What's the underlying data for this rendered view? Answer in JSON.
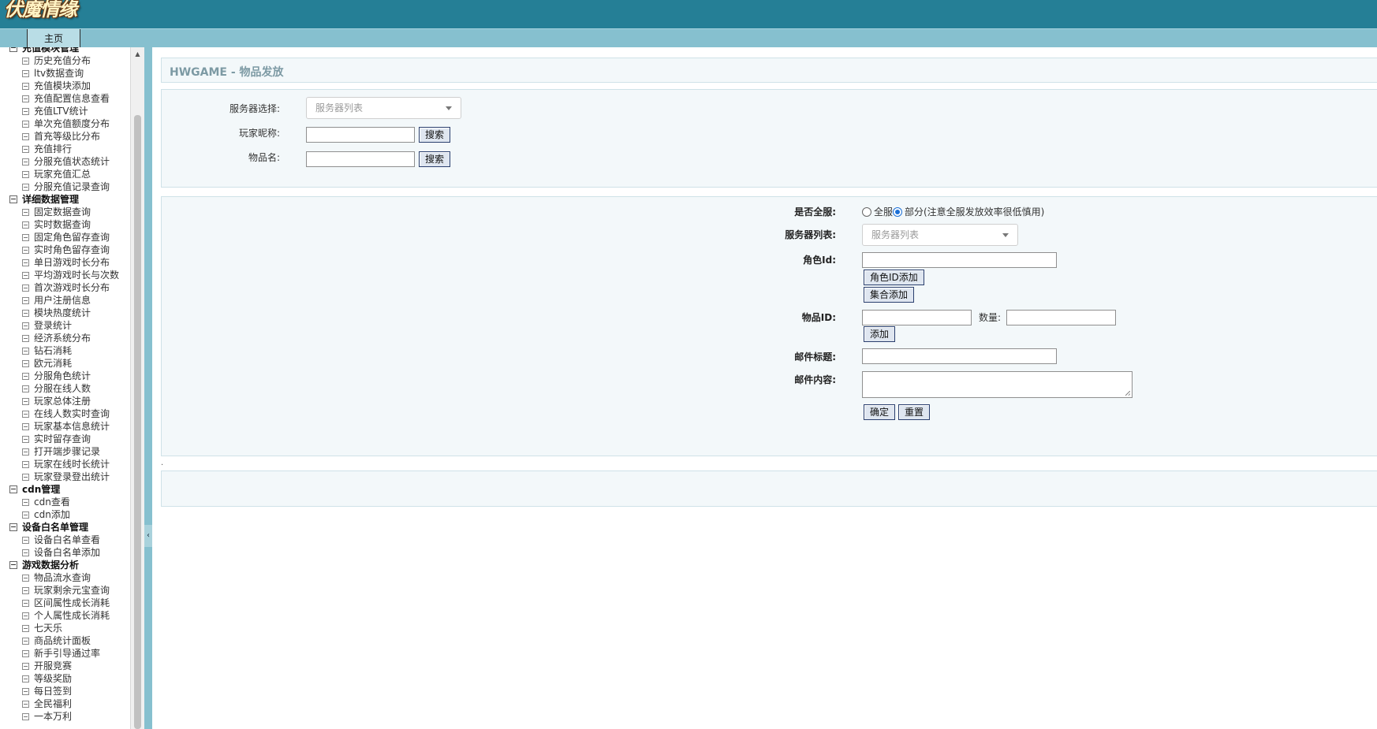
{
  "app": {
    "logo_text": "伏魔情缘"
  },
  "nav": {
    "tabs": [
      {
        "label": "主页"
      }
    ]
  },
  "sidebar": {
    "groups": [
      {
        "label": "充值模块管理",
        "items": [
          "历史充值分布",
          "ltv数据查询",
          "充值模块添加",
          "充值配置信息查看",
          "充值LTV统计",
          "单次充值额度分布",
          "首充等级比分布",
          "充值排行",
          "分服充值状态统计",
          "玩家充值汇总",
          "分服充值记录查询"
        ]
      },
      {
        "label": "详细数据管理",
        "items": [
          "固定数据查询",
          "实时数据查询",
          "固定角色留存查询",
          "实时角色留存查询",
          "单日游戏时长分布",
          "平均游戏时长与次数",
          "首次游戏时长分布",
          "用户注册信息",
          "模块热度统计",
          "登录统计",
          "经济系统分布",
          "钻石消耗",
          "欧元消耗",
          "分服角色统计",
          "分服在线人数",
          "玩家总体注册",
          "在线人数实时查询",
          "玩家基本信息统计",
          "实时留存查询",
          "打开端步骤记录",
          "玩家在线时长统计",
          "玩家登录登出统计"
        ]
      },
      {
        "label": "cdn管理",
        "items": [
          "cdn查看",
          "cdn添加"
        ]
      },
      {
        "label": "设备白名单管理",
        "items": [
          "设备白名单查看",
          "设备白名单添加"
        ]
      },
      {
        "label": "游戏数据分析",
        "items": [
          "物品流水查询",
          "玩家剩余元宝查询",
          "区间属性成长消耗",
          "个人属性成长消耗",
          "七天乐",
          "商品统计面板",
          "新手引导通过率",
          "开服竞赛",
          "等级奖励",
          "每日签到",
          "全民福利",
          "一本万利"
        ]
      }
    ]
  },
  "page": {
    "title": "HWGAME - 物品发放"
  },
  "search": {
    "server_label": "服务器选择:",
    "server_placeholder": "服务器列表",
    "nickname_label": "玩家昵称:",
    "item_name_label": "物品名:",
    "search_button": "搜索"
  },
  "send": {
    "all_server_label": "是否全服:",
    "radio_all": "全服",
    "radio_partial": "部分(注意全服发放效率很低慎用)",
    "selected": "partial",
    "server_list_label": "服务器列表:",
    "server_list_placeholder": "服务器列表",
    "role_id_label": "角色Id:",
    "role_id_add_button": "角色ID添加",
    "batch_add_button": "集合添加",
    "item_id_label": "物品ID:",
    "quantity_label": "数量:",
    "add_button": "添加",
    "mail_title_label": "邮件标题:",
    "mail_content_label": "邮件内容:",
    "confirm_button": "确定",
    "reset_button": "重置"
  },
  "misc": {
    "dot": "."
  }
}
